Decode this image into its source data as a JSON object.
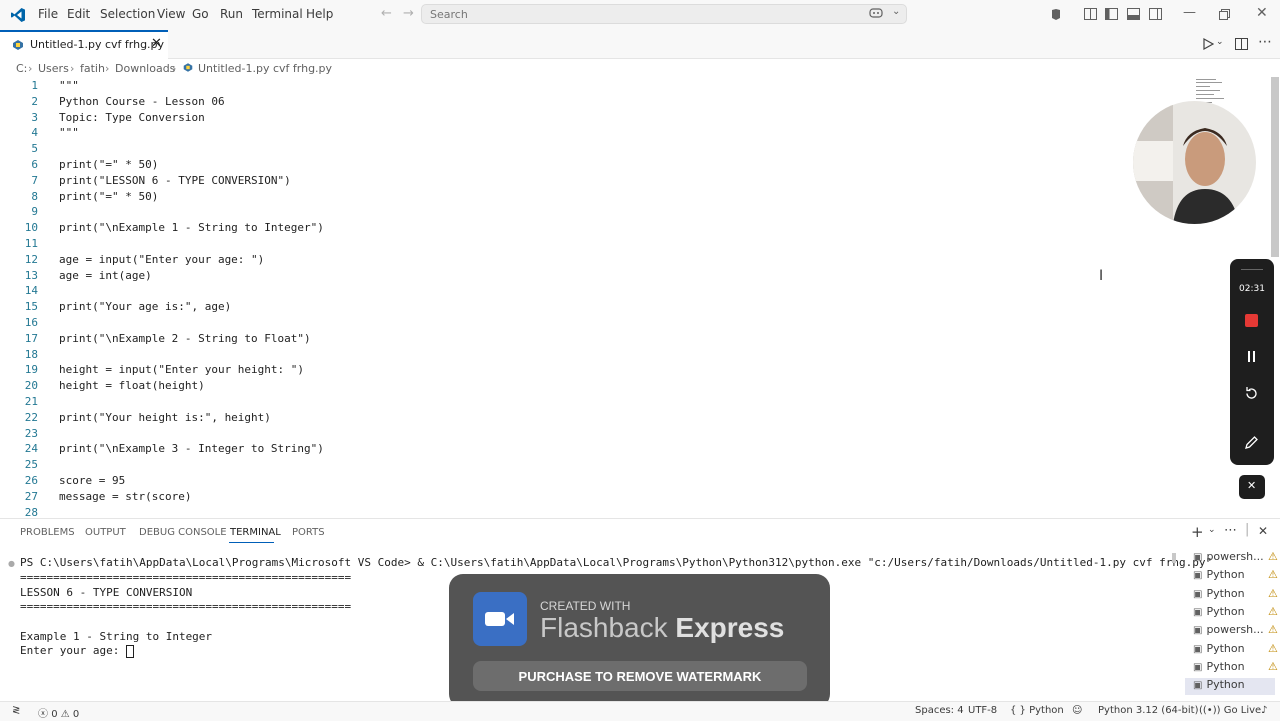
{
  "menu": [
    "File",
    "Edit",
    "Selection",
    "View",
    "Go",
    "Run",
    "Terminal",
    "Help"
  ],
  "search": {
    "placeholder": "Search"
  },
  "tab": {
    "label": "Untitled-1.py cvf frhg.py"
  },
  "breadcrumb": {
    "drive": "C:",
    "p1": "Users",
    "p2": "fatih",
    "p3": "Downloads",
    "file": "Untitled-1.py cvf frhg.py"
  },
  "code": [
    {
      "n": "1",
      "t": "\"\"\""
    },
    {
      "n": "2",
      "t": "Python Course - Lesson 06"
    },
    {
      "n": "3",
      "t": "Topic: Type Conversion"
    },
    {
      "n": "4",
      "t": "\"\"\""
    },
    {
      "n": "5",
      "t": ""
    },
    {
      "n": "6",
      "t": "print(\"=\" * 50)"
    },
    {
      "n": "7",
      "t": "print(\"LESSON 6 - TYPE CONVERSION\")"
    },
    {
      "n": "8",
      "t": "print(\"=\" * 50)"
    },
    {
      "n": "9",
      "t": ""
    },
    {
      "n": "10",
      "t": "print(\"\\nExample 1 - String to Integer\")"
    },
    {
      "n": "11",
      "t": ""
    },
    {
      "n": "12",
      "t": "age = input(\"Enter your age: \")"
    },
    {
      "n": "13",
      "t": "age = int(age)"
    },
    {
      "n": "14",
      "t": ""
    },
    {
      "n": "15",
      "t": "print(\"Your age is:\", age)"
    },
    {
      "n": "16",
      "t": ""
    },
    {
      "n": "17",
      "t": "print(\"\\nExample 2 - String to Float\")"
    },
    {
      "n": "18",
      "t": ""
    },
    {
      "n": "19",
      "t": "height = input(\"Enter your height: \")"
    },
    {
      "n": "20",
      "t": "height = float(height)"
    },
    {
      "n": "21",
      "t": ""
    },
    {
      "n": "22",
      "t": "print(\"Your height is:\", height)"
    },
    {
      "n": "23",
      "t": ""
    },
    {
      "n": "24",
      "t": "print(\"\\nExample 3 - Integer to String\")"
    },
    {
      "n": "25",
      "t": ""
    },
    {
      "n": "26",
      "t": "score = 95"
    },
    {
      "n": "27",
      "t": "message = str(score)"
    },
    {
      "n": "28",
      "t": ""
    }
  ],
  "panel": {
    "tabs": [
      "PROBLEMS",
      "OUTPUT",
      "DEBUG CONSOLE",
      "TERMINAL",
      "PORTS"
    ],
    "active_tab": "TERMINAL",
    "terminal_lines": [
      "PS C:\\Users\\fatih\\AppData\\Local\\Programs\\Microsoft VS Code> & C:\\Users\\fatih\\AppData\\Local\\Programs\\Python\\Python312\\python.exe \"c:/Users/fatih/Downloads/Untitled-1.py cvf frhg.py\"",
      "==================================================",
      "LESSON 6 - TYPE CONVERSION",
      "==================================================",
      "",
      "Example 1 - String to Integer",
      "Enter your age: "
    ],
    "terminals": [
      "powersh...",
      "Python",
      "Python",
      "Python",
      "powersh...",
      "Python",
      "Python",
      "Python"
    ]
  },
  "statusbar": {
    "errors": "0",
    "warnings": "0",
    "spaces": "Spaces: 4",
    "encoding": "UTF-8",
    "language": "{ } Python",
    "interpreter": "Python 3.12 (64-bit)",
    "golive": "Go Live"
  },
  "watermark": {
    "created": "CREATED WITH",
    "brand1": "Flashback",
    "brand2": "Express",
    "cta": "PURCHASE TO REMOVE WATERMARK"
  },
  "recorder": {
    "time": "02:31"
  },
  "colors": {
    "accent": "#005fb8",
    "record": "#e53935",
    "line_number": "#237893"
  }
}
